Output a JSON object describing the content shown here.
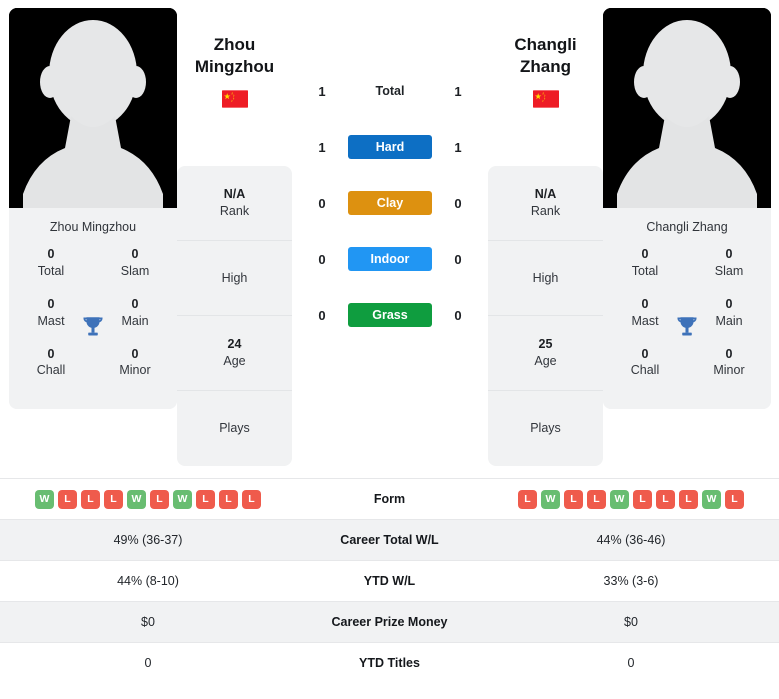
{
  "players": [
    {
      "id": "left",
      "display_name": "Zhou\nMingzhou",
      "name_line1": "Zhou",
      "name_line2": "Mingzhou",
      "photo_caption": "Zhou Mingzhou",
      "country": "China",
      "flag_icon": "flag-china-icon",
      "titles": [
        {
          "value": "0",
          "label": "Total"
        },
        {
          "value": "0",
          "label": "Slam"
        },
        {
          "value": "0",
          "label": "Mast"
        },
        {
          "value": "0",
          "label": "Main"
        },
        {
          "value": "0",
          "label": "Chall"
        },
        {
          "value": "0",
          "label": "Minor"
        }
      ],
      "meta": [
        {
          "value": "N/A",
          "label": "Rank"
        },
        {
          "value": "",
          "label": "High"
        },
        {
          "value": "24",
          "label": "Age"
        },
        {
          "value": "",
          "label": "Plays"
        }
      ],
      "form": [
        "W",
        "L",
        "L",
        "L",
        "W",
        "L",
        "W",
        "L",
        "L",
        "L"
      ],
      "career_total_wl": "49% (36-37)",
      "ytd_wl": "44% (8-10)",
      "career_prize_money": "$0",
      "ytd_titles": "0"
    },
    {
      "id": "right",
      "display_name": "Changli\nZhang",
      "name_line1": "Changli",
      "name_line2": "Zhang",
      "photo_caption": "Changli Zhang",
      "country": "China",
      "flag_icon": "flag-china-icon",
      "titles": [
        {
          "value": "0",
          "label": "Total"
        },
        {
          "value": "0",
          "label": "Slam"
        },
        {
          "value": "0",
          "label": "Mast"
        },
        {
          "value": "0",
          "label": "Main"
        },
        {
          "value": "0",
          "label": "Chall"
        },
        {
          "value": "0",
          "label": "Minor"
        }
      ],
      "meta": [
        {
          "value": "N/A",
          "label": "Rank"
        },
        {
          "value": "",
          "label": "High"
        },
        {
          "value": "25",
          "label": "Age"
        },
        {
          "value": "",
          "label": "Plays"
        }
      ],
      "form": [
        "L",
        "W",
        "L",
        "L",
        "W",
        "L",
        "L",
        "L",
        "W",
        "L"
      ],
      "career_total_wl": "44% (36-46)",
      "ytd_wl": "33% (3-6)",
      "career_prize_money": "$0",
      "ytd_titles": "0"
    }
  ],
  "surfaces": [
    {
      "key": "total",
      "label": "Total",
      "left": "1",
      "right": "1",
      "style": "plain",
      "color": ""
    },
    {
      "key": "hard",
      "label": "Hard",
      "left": "1",
      "right": "1",
      "style": "pill",
      "color": "#0d6fc4"
    },
    {
      "key": "clay",
      "label": "Clay",
      "left": "0",
      "right": "0",
      "style": "pill",
      "color": "#dd9110"
    },
    {
      "key": "indoor",
      "label": "Indoor",
      "left": "0",
      "right": "0",
      "style": "pill",
      "color": "#2196f3"
    },
    {
      "key": "grass",
      "label": "Grass",
      "left": "0",
      "right": "0",
      "style": "pill",
      "color": "#0f9d3f"
    }
  ],
  "stats_rows": [
    {
      "key": "form",
      "label": "Form"
    },
    {
      "key": "career_total_wl",
      "label": "Career Total W/L"
    },
    {
      "key": "ytd_wl",
      "label": "YTD W/L"
    },
    {
      "key": "career_prize_money",
      "label": "Career Prize Money"
    },
    {
      "key": "ytd_titles",
      "label": "YTD Titles"
    }
  ],
  "colors": {
    "win_badge": "#68bd71",
    "loss_badge": "#ef5b4c",
    "card_bg": "#f1f2f3",
    "row_alt_bg": "#f1f2f3",
    "trophy": "#3e72b9",
    "flag_red": "#ee1c25",
    "flag_star": "#ffde00"
  }
}
